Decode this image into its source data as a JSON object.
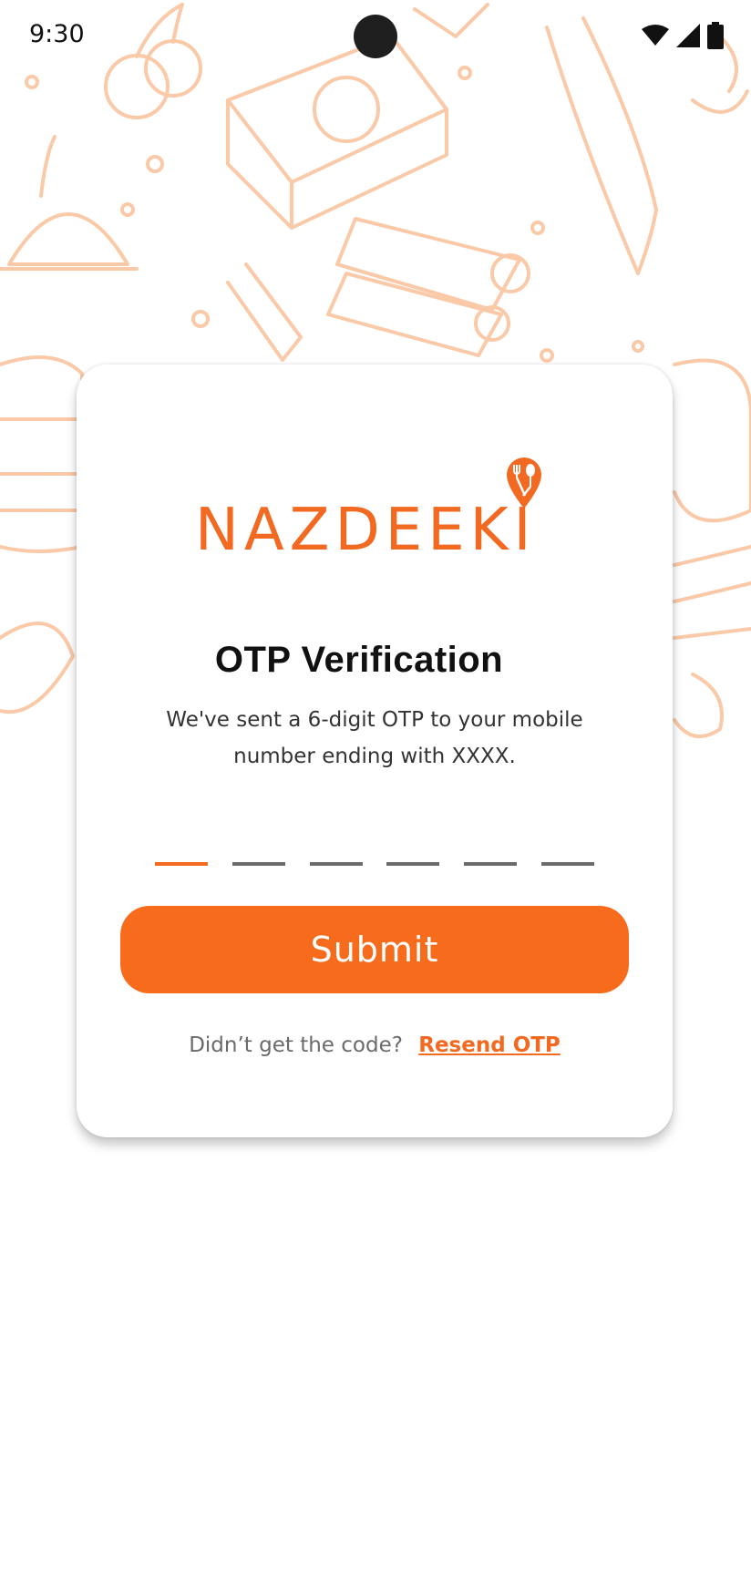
{
  "status_bar": {
    "time": "9:30"
  },
  "brand": {
    "name": "NAZDEEKI",
    "color": "#f26a21"
  },
  "otp": {
    "title": "OTP Verification",
    "message": "We've sent a 6-digit OTP to your mobile number ending with XXXX.",
    "slots": [
      "",
      "",
      "",
      "",
      "",
      ""
    ]
  },
  "submit": {
    "label": "Submit",
    "color": "#f76b1c"
  },
  "resend": {
    "question": "Didn’t get the code?",
    "link_label": "Resend OTP"
  },
  "icons": {
    "wifi": "wifi-icon",
    "signal": "cellular-signal-icon",
    "battery": "battery-icon",
    "logo_pin": "map-pin-fork-spoon-icon"
  }
}
